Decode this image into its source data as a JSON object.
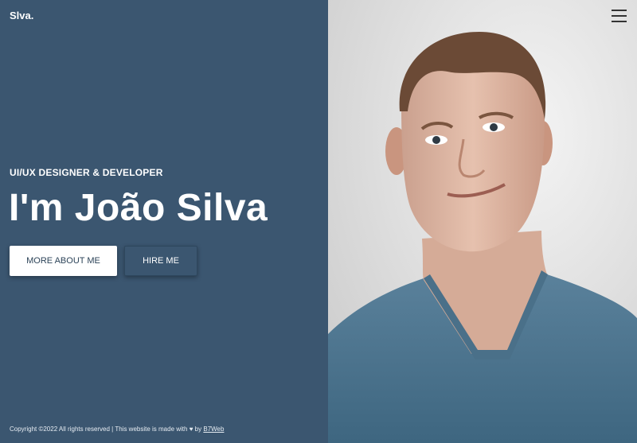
{
  "brand": {
    "logo": "Slva."
  },
  "hero": {
    "subtitle": "UI/UX DESIGNER & DEVELOPER",
    "headline": "I'm João Silva",
    "primary_button": "MORE ABOUT ME",
    "secondary_button": "HIRE ME"
  },
  "footer": {
    "text": "Copyright ©2022 All rights reserved | This website is made with ♥ by",
    "link": "B7Web"
  },
  "nav": {
    "menu_icon": "hamburger-menu-icon"
  },
  "colors": {
    "panel": "#3b5670",
    "button_text": "#2c4358",
    "shirt": "#4d7590",
    "background_right": "#eeeeee"
  }
}
